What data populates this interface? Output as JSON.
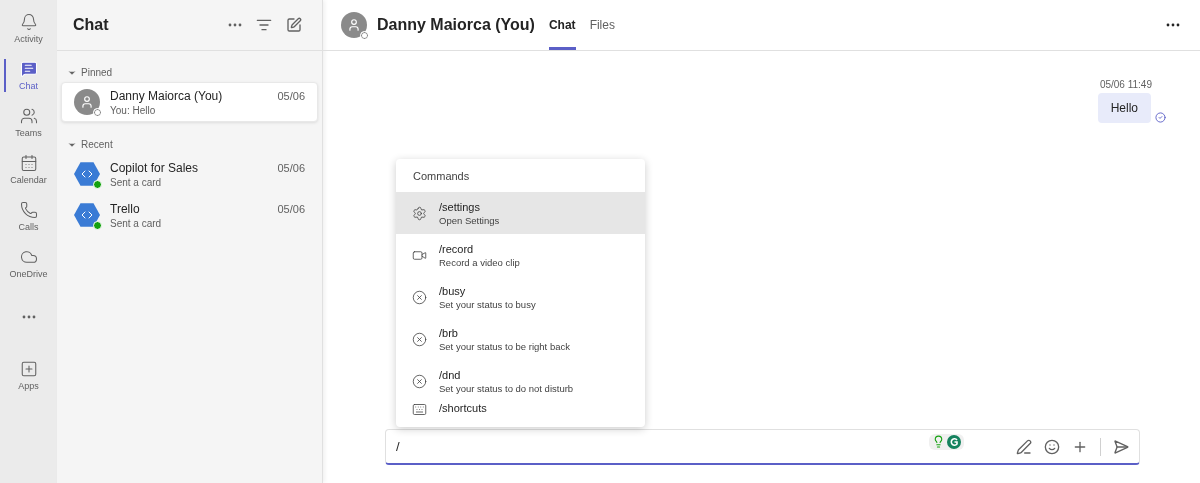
{
  "rail": [
    {
      "label": "Activity",
      "selected": false
    },
    {
      "label": "Chat",
      "selected": true
    },
    {
      "label": "Teams",
      "selected": false
    },
    {
      "label": "Calendar",
      "selected": false
    },
    {
      "label": "Calls",
      "selected": false
    },
    {
      "label": "OneDrive",
      "selected": false
    },
    {
      "selected": false
    },
    {
      "label": "Apps",
      "selected": false
    }
  ],
  "chat_list": {
    "title": "Chat",
    "sections": [
      {
        "title": "Pinned",
        "items": [
          {
            "name": "Danny Maiorca (You)",
            "preview": "You: Hello",
            "date": "05/06",
            "kind": "person",
            "selected": true
          }
        ]
      },
      {
        "title": "Recent",
        "items": [
          {
            "name": "Copilot for Sales",
            "preview": "Sent a card",
            "date": "05/06",
            "kind": "bot",
            "selected": false
          },
          {
            "name": "Trello",
            "preview": "Sent a card",
            "date": "05/06",
            "kind": "bot",
            "selected": false
          }
        ]
      }
    ]
  },
  "header": {
    "name": "Danny Maiorca (You)",
    "tabs": [
      {
        "label": "Chat",
        "selected": true
      },
      {
        "label": "Files",
        "selected": false
      }
    ]
  },
  "messages": [
    {
      "time": "05/06 11:49",
      "text": "Hello"
    }
  ],
  "commands": {
    "title": "Commands",
    "items": [
      {
        "name": "/settings",
        "description": "Open Settings",
        "selected": true
      },
      {
        "name": "/record",
        "description": "Record a video clip",
        "selected": false
      },
      {
        "name": "/busy",
        "description": "Set your status to busy",
        "selected": false
      },
      {
        "name": "/brb",
        "description": "Set your status to be right back",
        "selected": false
      },
      {
        "name": "/dnd",
        "description": "Set your status to do not disturb",
        "selected": false
      },
      {
        "name": "/shortcuts",
        "selected": false
      }
    ]
  },
  "compose": {
    "value": "/"
  }
}
